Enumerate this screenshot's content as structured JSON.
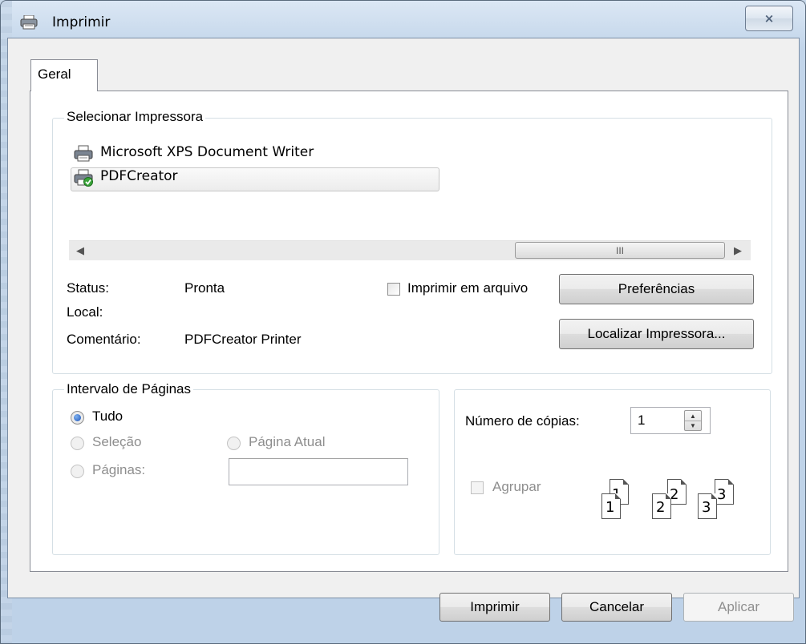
{
  "window": {
    "title": "Imprimir",
    "close_glyph": "⨯"
  },
  "tabs": [
    {
      "label": "Geral"
    }
  ],
  "printer_group": {
    "label": "Selecionar Impressora",
    "printers": [
      {
        "name": "Microsoft XPS Document Writer",
        "icon": "printer-icon",
        "selected": false
      },
      {
        "name": "PDFCreator",
        "icon": "printer-default-icon",
        "selected": true
      }
    ],
    "scrollbar_thumb_glyph": "III",
    "status_label": "Status:",
    "status_value": "Pronta",
    "location_label": "Local:",
    "location_value": "",
    "comment_label": "Comentário:",
    "comment_value": "PDFCreator Printer",
    "print_to_file_label": "Imprimir em arquivo",
    "preferences_label": "Preferências",
    "find_printer_label": "Localizar Impressora..."
  },
  "page_range": {
    "label": "Intervalo de Páginas",
    "all_label": "Tudo",
    "selection_label": "Seleção",
    "current_page_label": "Página Atual",
    "pages_label": "Páginas:",
    "pages_value": ""
  },
  "copies": {
    "label": "Número de cópias:",
    "value": "1",
    "collate_label": "Agrupar",
    "collate_numbers": [
      "1",
      "1",
      "2",
      "2",
      "3",
      "3"
    ]
  },
  "footer": {
    "print_label": "Imprimir",
    "cancel_label": "Cancelar",
    "apply_label": "Aplicar"
  }
}
